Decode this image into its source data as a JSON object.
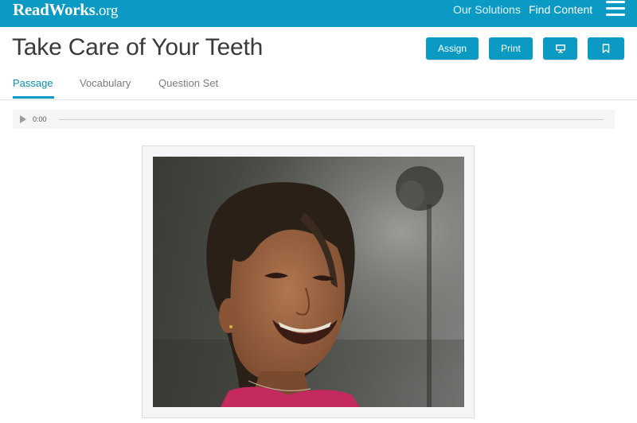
{
  "header": {
    "logo_main": "ReadWorks",
    "logo_suffix": ".org",
    "nav": [
      {
        "label": "Our Solutions"
      },
      {
        "label": "Find Content"
      }
    ]
  },
  "page": {
    "title": "Take Care of Your Teeth",
    "actions": {
      "assign_label": "Assign",
      "print_label": "Print"
    }
  },
  "tabs": [
    {
      "label": "Passage",
      "active": true
    },
    {
      "label": "Vocabulary",
      "active": false
    },
    {
      "label": "Question Set",
      "active": false
    }
  ],
  "audio": {
    "time": "0:00"
  },
  "colors": {
    "brand": "#0b9ac3",
    "active_tab": "#0b8fb6"
  },
  "icons": {
    "present": "monitor-icon",
    "bookmark": "bookmark-icon",
    "menu": "hamburger-menu-icon",
    "play": "play-icon"
  }
}
